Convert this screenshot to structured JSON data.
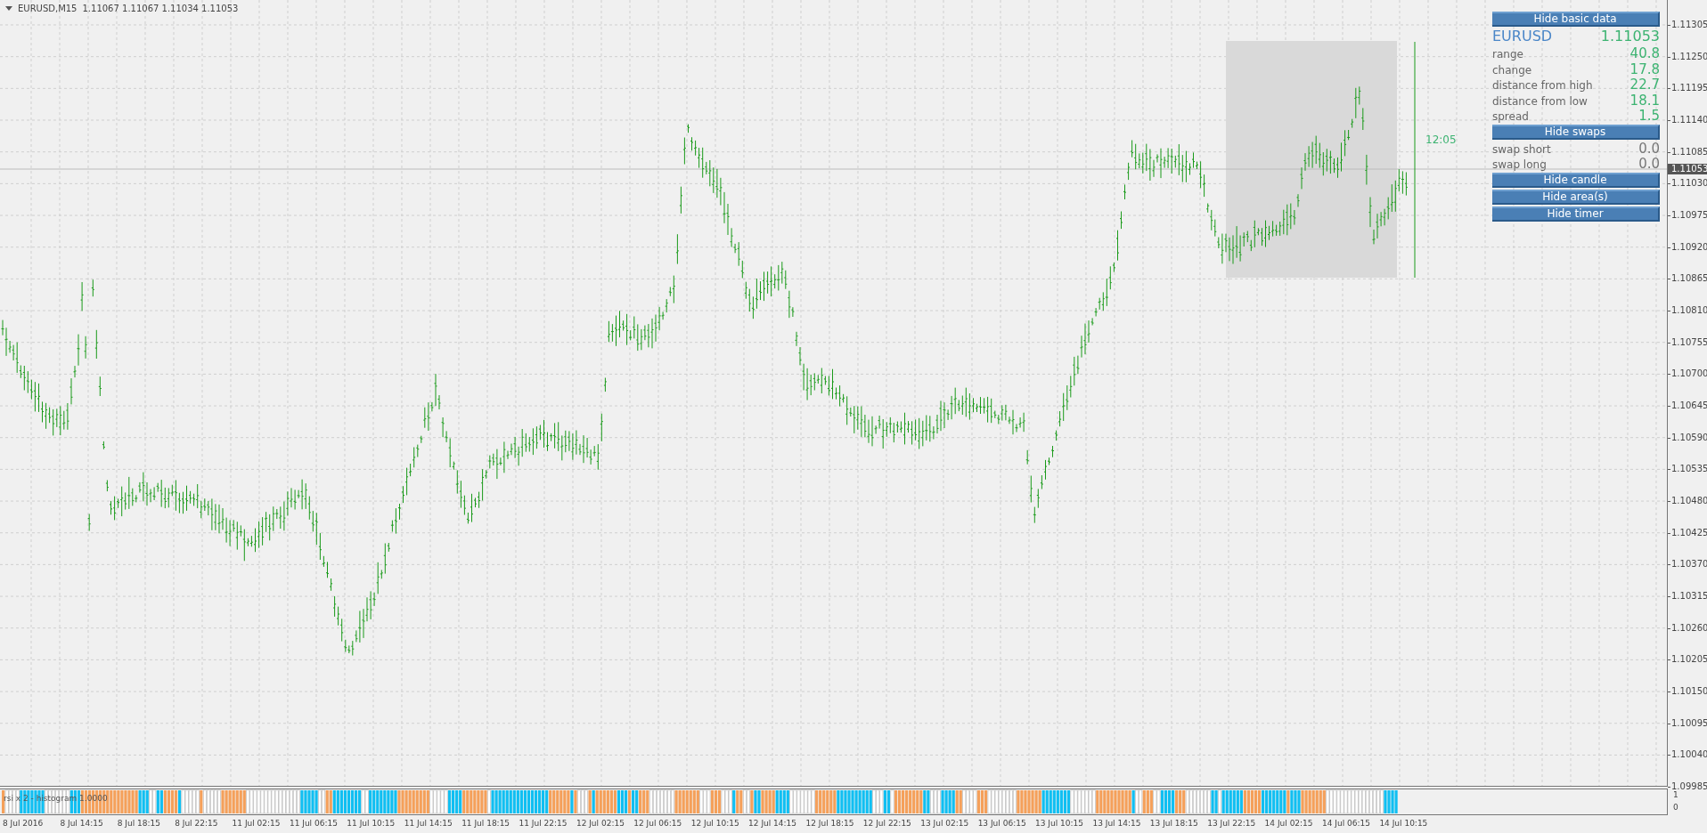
{
  "header": {
    "symbol": "EURUSD,M15",
    "ohlc": "1.11067 1.11067 1.11034 1.11053"
  },
  "panel": [
    {
      "kind": "button",
      "label": "Hide basic data"
    },
    {
      "kind": "title",
      "label": "EURUSD",
      "value": "1.11053"
    },
    {
      "kind": "stat",
      "label": "range",
      "value": "40.8"
    },
    {
      "kind": "stat",
      "label": "change",
      "value": "17.8"
    },
    {
      "kind": "stat",
      "label": "distance from high",
      "value": "22.7"
    },
    {
      "kind": "stat",
      "label": "distance from low",
      "value": "18.1"
    },
    {
      "kind": "stat",
      "label": "spread",
      "value": "1.5"
    },
    {
      "kind": "button",
      "label": "Hide swaps"
    },
    {
      "kind": "swap",
      "label": "swap short",
      "value": "0.0"
    },
    {
      "kind": "swap",
      "label": "swap long",
      "value": "0.0"
    },
    {
      "kind": "button",
      "label": "Hide candle"
    },
    {
      "kind": "button",
      "label": "Hide area(s)"
    },
    {
      "kind": "button",
      "label": "Hide timer"
    }
  ],
  "timer": "12:05",
  "current_price": "1.11053",
  "price_axis": [
    "1.11305",
    "1.11250",
    "1.11195",
    "1.11140",
    "1.11085",
    "1.11030",
    "1.10975",
    "1.10920",
    "1.10865",
    "1.10810",
    "1.10755",
    "1.10700",
    "1.10645",
    "1.10590",
    "1.10535",
    "1.10480",
    "1.10425",
    "1.10370",
    "1.10315",
    "1.10260",
    "1.10205",
    "1.10150",
    "1.10095",
    "1.10040",
    "1.09985"
  ],
  "indicator": {
    "label": "rsi x 2 - histogram 1.0000",
    "axis": [
      "1",
      "0"
    ]
  },
  "time_axis": [
    "8 Jul 2016",
    "8 Jul 14:15",
    "8 Jul 18:15",
    "8 Jul 22:15",
    "11 Jul 02:15",
    "11 Jul 06:15",
    "11 Jul 10:15",
    "11 Jul 14:15",
    "11 Jul 18:15",
    "11 Jul 22:15",
    "12 Jul 02:15",
    "12 Jul 06:15",
    "12 Jul 10:15",
    "12 Jul 14:15",
    "12 Jul 18:15",
    "12 Jul 22:15",
    "13 Jul 02:15",
    "13 Jul 06:15",
    "13 Jul 10:15",
    "13 Jul 14:15",
    "13 Jul 18:15",
    "13 Jul 22:15",
    "14 Jul 02:15",
    "14 Jul 06:15",
    "14 Jul 10:15"
  ]
}
